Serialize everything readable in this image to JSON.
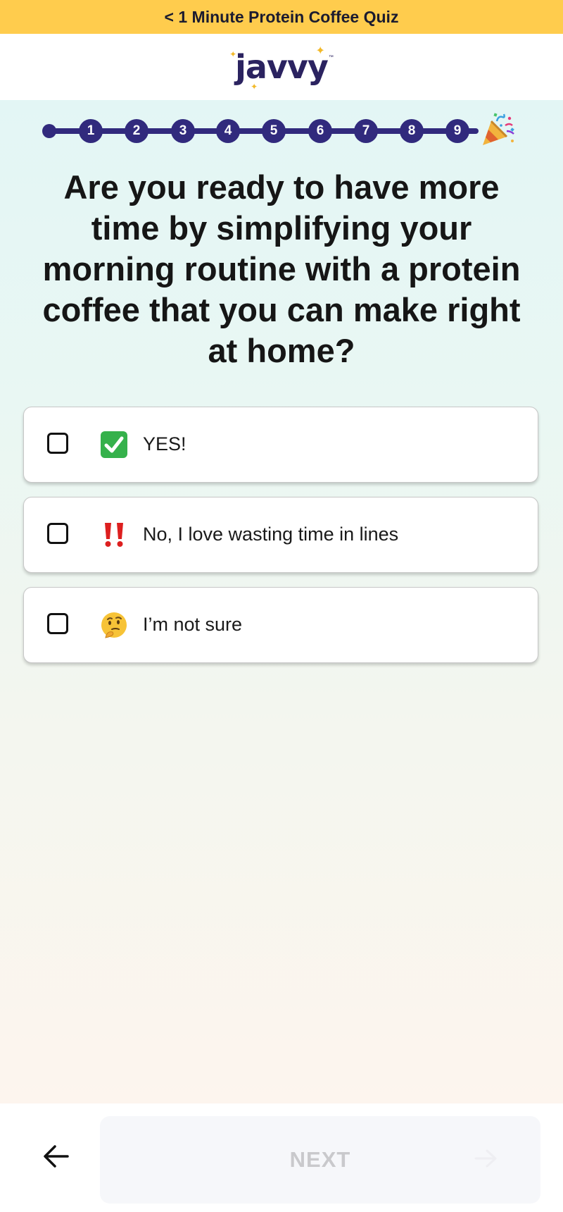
{
  "banner": {
    "text": "< 1 Minute Protein Coffee Quiz"
  },
  "brand": {
    "logo_text": "javvy",
    "trademark": "™"
  },
  "progress": {
    "steps": [
      "1",
      "2",
      "3",
      "4",
      "5",
      "6",
      "7",
      "8",
      "9"
    ],
    "end_icon": "party-popper-icon",
    "color": "#312a7d"
  },
  "question": {
    "text": "Are you ready to have more time by simplifying your morning routine with a protein coffee that you can make right at home?"
  },
  "options": [
    {
      "label": "YES!",
      "icon": "check-mark-button-icon",
      "checked": false
    },
    {
      "label": "No, I love wasting time in lines",
      "icon": "double-exclamation-icon",
      "checked": false
    },
    {
      "label": "I’m not sure",
      "icon": "thinking-face-icon",
      "checked": false
    }
  ],
  "footer": {
    "back_icon": "arrow-left-icon",
    "next_label": "NEXT",
    "next_icon": "arrow-right-icon",
    "next_disabled": true
  },
  "colors": {
    "banner": "#FFCC4D",
    "brand": "#2b2360",
    "accent_star": "#f2b929"
  }
}
